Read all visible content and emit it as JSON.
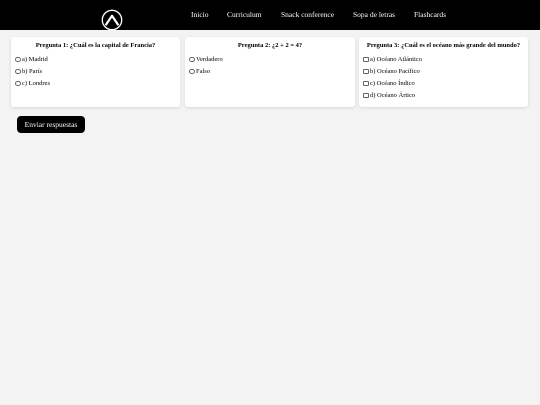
{
  "nav": {
    "logo_icon": "peak-logo-icon",
    "links": [
      "Inicio",
      "Curriculum",
      "Snack conference",
      "Sopa de letras",
      "Flashcards"
    ]
  },
  "questions": [
    {
      "title": "Pregunta 1: ¿Cuál es la capital de Francia?",
      "input": "radio",
      "options": [
        "a) Madrid",
        "b) París",
        "c) Londres"
      ]
    },
    {
      "title": "Pregunta 2: ¿2 + 2 = 4?",
      "input": "radio",
      "options": [
        "Verdadero",
        "Falso"
      ]
    },
    {
      "title": "Pregunta 3: ¿Cuál es el océano más grande del mundo?",
      "input": "checkbox",
      "options": [
        "a) Océano Atlántico",
        "b) Océano Pacífico",
        "c) Océano Índico",
        "d) Océano Ártico"
      ]
    }
  ],
  "submit_label": "Enviar respuestas",
  "colors": {
    "navbar": "#000000",
    "background": "#f3f3f3",
    "card": "#ffffff",
    "button": "#000000"
  }
}
